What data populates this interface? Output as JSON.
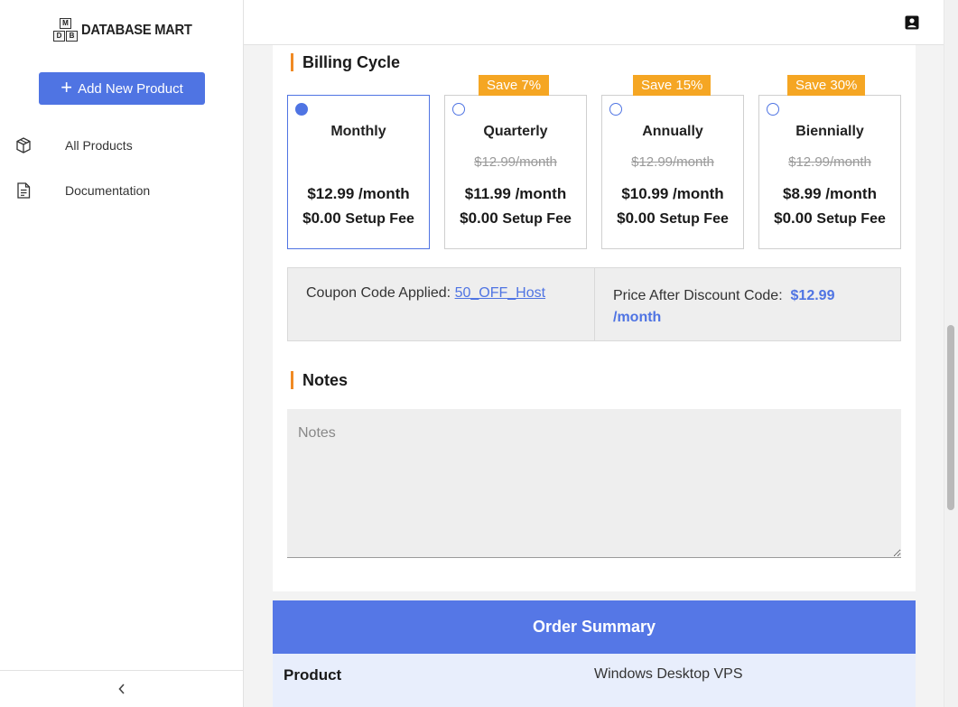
{
  "sidebar": {
    "logo_text": "DATABASE MART",
    "logo_letters": [
      "M",
      "D",
      "B"
    ],
    "add_button_label": "Add New Product",
    "items": [
      {
        "label": "All Products",
        "icon": "box-icon"
      },
      {
        "label": "Documentation",
        "icon": "document-icon"
      }
    ]
  },
  "billing": {
    "title": "Billing Cycle",
    "plans": [
      {
        "name": "Monthly",
        "original": "",
        "price": "$12.99 /month",
        "setup_amount": "$0.00",
        "setup_label": "Setup Fee",
        "badge": "",
        "selected": true
      },
      {
        "name": "Quarterly",
        "original": "$12.99/month",
        "price": "$11.99 /month",
        "setup_amount": "$0.00",
        "setup_label": "Setup Fee",
        "badge": "Save 7%",
        "selected": false
      },
      {
        "name": "Annually",
        "original": "$12.99/month",
        "price": "$10.99 /month",
        "setup_amount": "$0.00",
        "setup_label": "Setup Fee",
        "badge": "Save 15%",
        "selected": false
      },
      {
        "name": "Biennially",
        "original": "$12.99/month",
        "price": "$8.99 /month",
        "setup_amount": "$0.00",
        "setup_label": "Setup Fee",
        "badge": "Save 30%",
        "selected": false
      }
    ]
  },
  "coupon": {
    "label": "Coupon Code Applied:",
    "code": "50_OFF_Host",
    "price_label": "Price After Discount Code:",
    "price_value": "$12.99",
    "price_unit": "/month"
  },
  "notes": {
    "title": "Notes",
    "placeholder": "Notes"
  },
  "summary": {
    "title": "Order Summary",
    "rows": [
      {
        "key": "Product",
        "value": "Windows Desktop VPS"
      }
    ]
  },
  "colors": {
    "accent": "#4f74e3",
    "badge": "#f5a623",
    "section_marker": "#f08a24"
  }
}
